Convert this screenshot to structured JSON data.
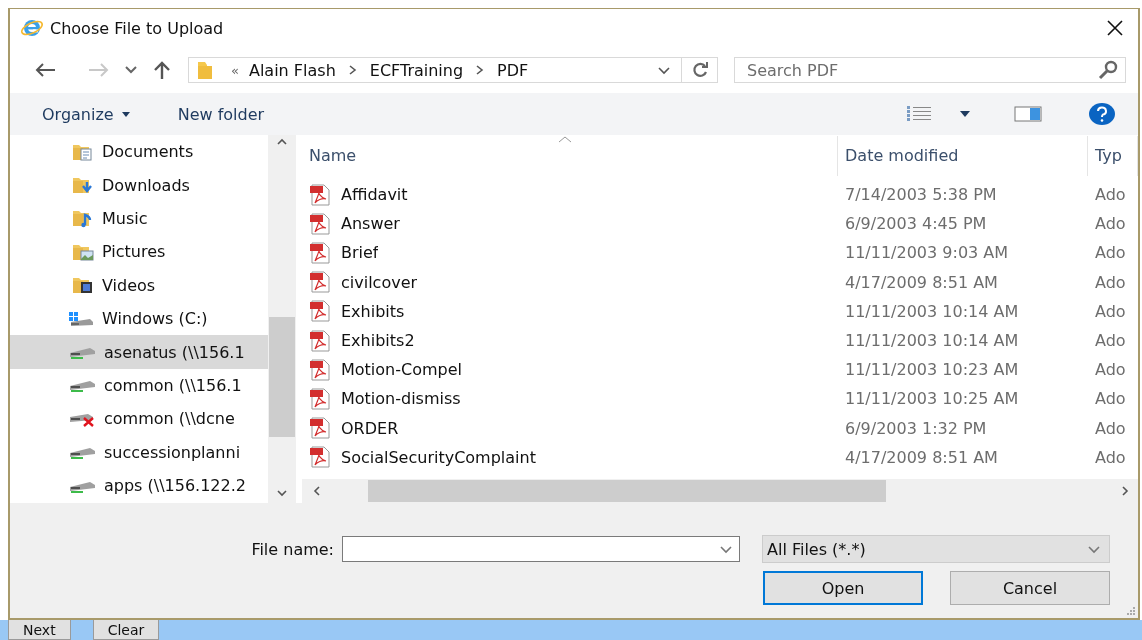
{
  "window": {
    "title": "Choose File to Upload"
  },
  "address": {
    "overflow": "«",
    "crumbs": [
      "Alain Flash",
      "ECFTraining",
      "PDF"
    ]
  },
  "search": {
    "placeholder": "Search PDF"
  },
  "toolbar": {
    "organize": "Organize",
    "new_folder": "New folder"
  },
  "sidebar": {
    "items": [
      {
        "label": "Documents",
        "kind": "documents",
        "selected": false
      },
      {
        "label": "Downloads",
        "kind": "downloads",
        "selected": false
      },
      {
        "label": "Music",
        "kind": "music",
        "selected": false
      },
      {
        "label": "Pictures",
        "kind": "pictures",
        "selected": false
      },
      {
        "label": "Videos",
        "kind": "videos",
        "selected": false
      },
      {
        "label": "Windows (C:)",
        "kind": "system-drive",
        "selected": false
      },
      {
        "label": "asenatus (\\\\156.1",
        "kind": "network-drive",
        "selected": true
      },
      {
        "label": "common (\\\\156.1",
        "kind": "network-drive",
        "selected": false
      },
      {
        "label": "common (\\\\dcne",
        "kind": "disconnected-drive",
        "selected": false
      },
      {
        "label": "successionplanni",
        "kind": "network-drive",
        "selected": false
      },
      {
        "label": "apps (\\\\156.122.2",
        "kind": "network-drive",
        "selected": false
      }
    ]
  },
  "columns": [
    "Name",
    "Date modified",
    "Typ"
  ],
  "files": [
    {
      "name": "Affidavit",
      "date": "7/14/2003 5:38 PM",
      "type": "Ado"
    },
    {
      "name": "Answer",
      "date": "6/9/2003 4:45 PM",
      "type": "Ado"
    },
    {
      "name": "Brief",
      "date": "11/11/2003 9:03 AM",
      "type": "Ado"
    },
    {
      "name": "civilcover",
      "date": "4/17/2009 8:51 AM",
      "type": "Ado"
    },
    {
      "name": "Exhibits",
      "date": "11/11/2003 10:14 AM",
      "type": "Ado"
    },
    {
      "name": "Exhibits2",
      "date": "11/11/2003 10:14 AM",
      "type": "Ado"
    },
    {
      "name": "Motion-Compel",
      "date": "11/11/2003 10:23 AM",
      "type": "Ado"
    },
    {
      "name": "Motion-dismiss",
      "date": "11/11/2003 10:25 AM",
      "type": "Ado"
    },
    {
      "name": "ORDER",
      "date": "6/9/2003 1:32 PM",
      "type": "Ado"
    },
    {
      "name": "SocialSecurityComplaint",
      "date": "4/17/2009 8:51 AM",
      "type": "Ado"
    }
  ],
  "file_name": {
    "label": "File name:"
  },
  "file_type": {
    "value": "All Files (*.*)"
  },
  "buttons": [
    {
      "label": "Open",
      "default": true
    },
    {
      "label": "Cancel",
      "default": false
    }
  ],
  "page_buttons": [
    "Next",
    "Clear"
  ]
}
